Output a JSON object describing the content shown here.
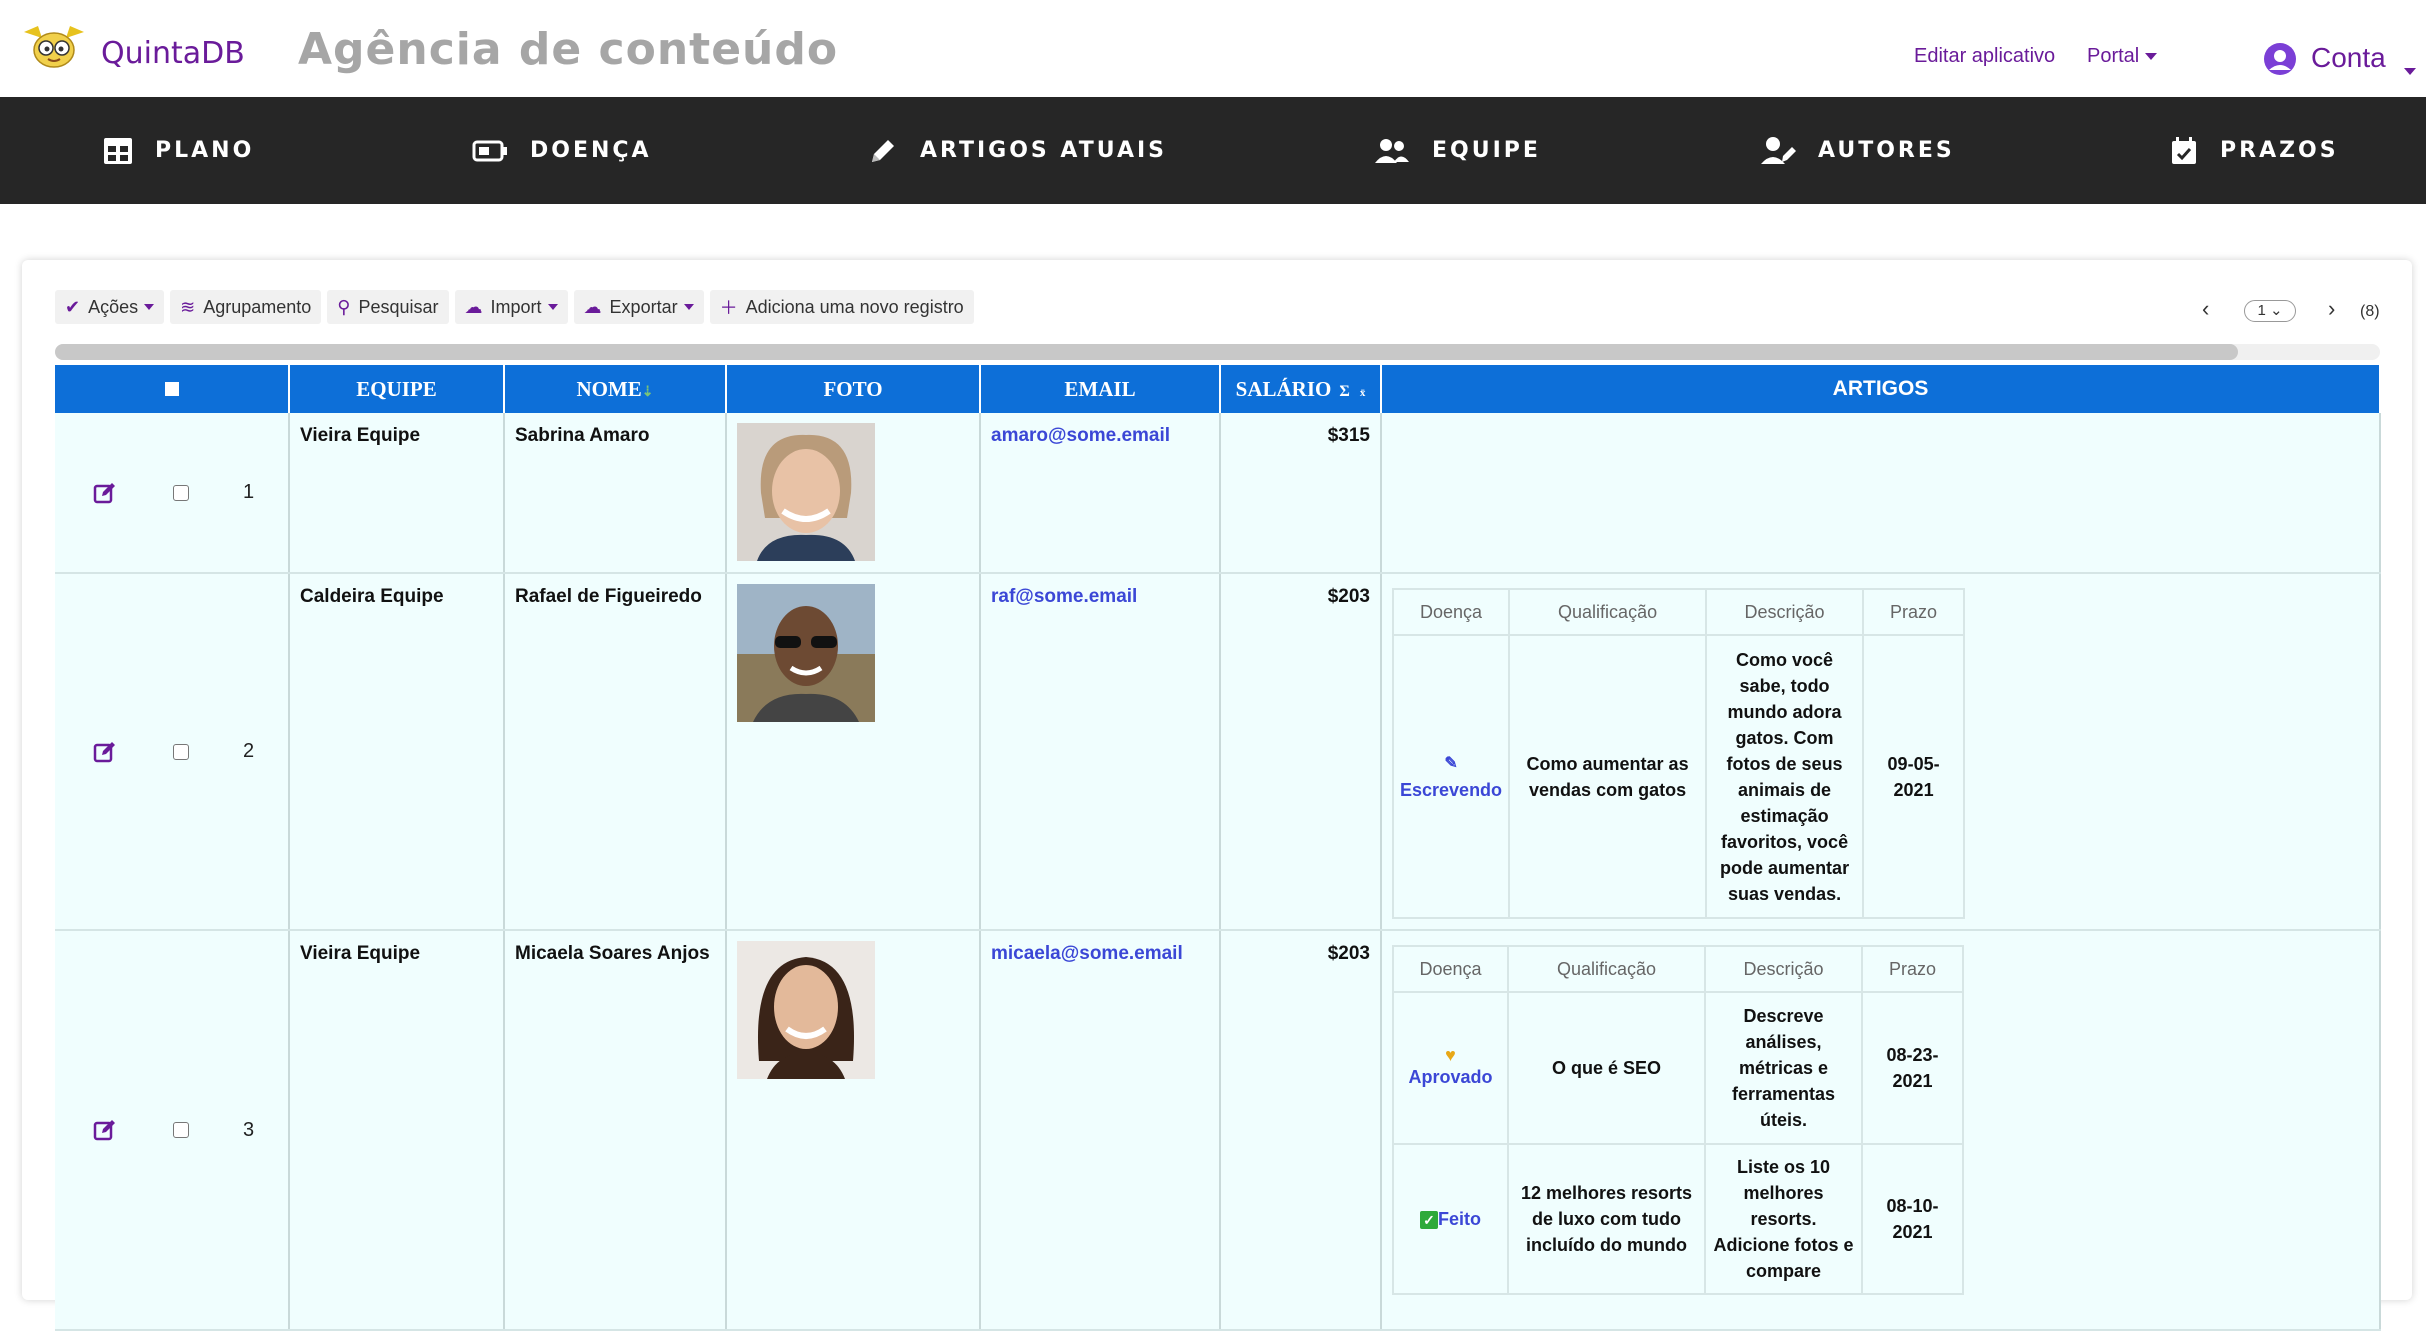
{
  "header": {
    "brand": "QuintaDB",
    "app_title": "Agência de conteúdo",
    "edit_app": "Editar aplicativo",
    "portal": "Portal",
    "account": "Conta",
    "accent_color": "#6a1b9a"
  },
  "nav": {
    "items": [
      {
        "label": "PLANO",
        "icon": "grid-icon"
      },
      {
        "label": "DOENÇA",
        "icon": "battery-icon"
      },
      {
        "label": "ARTIGOS ATUAIS",
        "icon": "pencil-icon"
      },
      {
        "label": "EQUIPE",
        "icon": "users-icon"
      },
      {
        "label": "AUTORES",
        "icon": "user-edit-icon"
      },
      {
        "label": "PRAZOS",
        "icon": "calendar-check-icon"
      }
    ]
  },
  "toolbar": {
    "actions": "Ações",
    "grouping": "Agrupamento",
    "search": "Pesquisar",
    "import": "Import",
    "export": "Exportar",
    "add": "Adiciona uma novo registro"
  },
  "pager": {
    "page": "1",
    "count": "(8)"
  },
  "table": {
    "columns": [
      "EQUIPE",
      "NOME",
      "FOTO",
      "EMAIL",
      "SALÁRIO",
      "ARTIGOS"
    ],
    "header_color": "#0d6fd8",
    "rows": [
      {
        "num": "1",
        "team": "Vieira Equipe",
        "name": "Sabrina Amaro",
        "email": "amaro@some.email",
        "salary": "$315"
      },
      {
        "num": "2",
        "team": "Caldeira Equipe",
        "name": "Rafael de Figueiredo",
        "email": "raf@some.email",
        "salary": "$203"
      },
      {
        "num": "3",
        "team": "Vieira Equipe",
        "name": "Micaela Soares Anjos",
        "email": "micaela@some.email",
        "salary": "$203"
      }
    ]
  },
  "articles": {
    "columns": [
      "Doença",
      "Qualificação",
      "Descrição",
      "Prazo"
    ],
    "row2": [
      {
        "status": "Escrevendo",
        "title": "Como aumentar as vendas com gatos",
        "description": "Como você sabe, todo mundo adora gatos. Com fotos de seus animais de estimação favoritos, você pode aumentar suas vendas.",
        "deadline": "09-05-2021"
      }
    ],
    "row3": [
      {
        "status": "Aprovado",
        "title": "O que é SEO",
        "description": "Descreve análises, métricas e ferramentas úteis.",
        "deadline": "08-23-2021"
      },
      {
        "status": "Feito",
        "title": "12 melhores resorts de luxo com tudo incluído do mundo",
        "description": "Liste os 10 melhores resorts. Adicione fotos e compare",
        "deadline": "08-10-2021"
      }
    ]
  }
}
